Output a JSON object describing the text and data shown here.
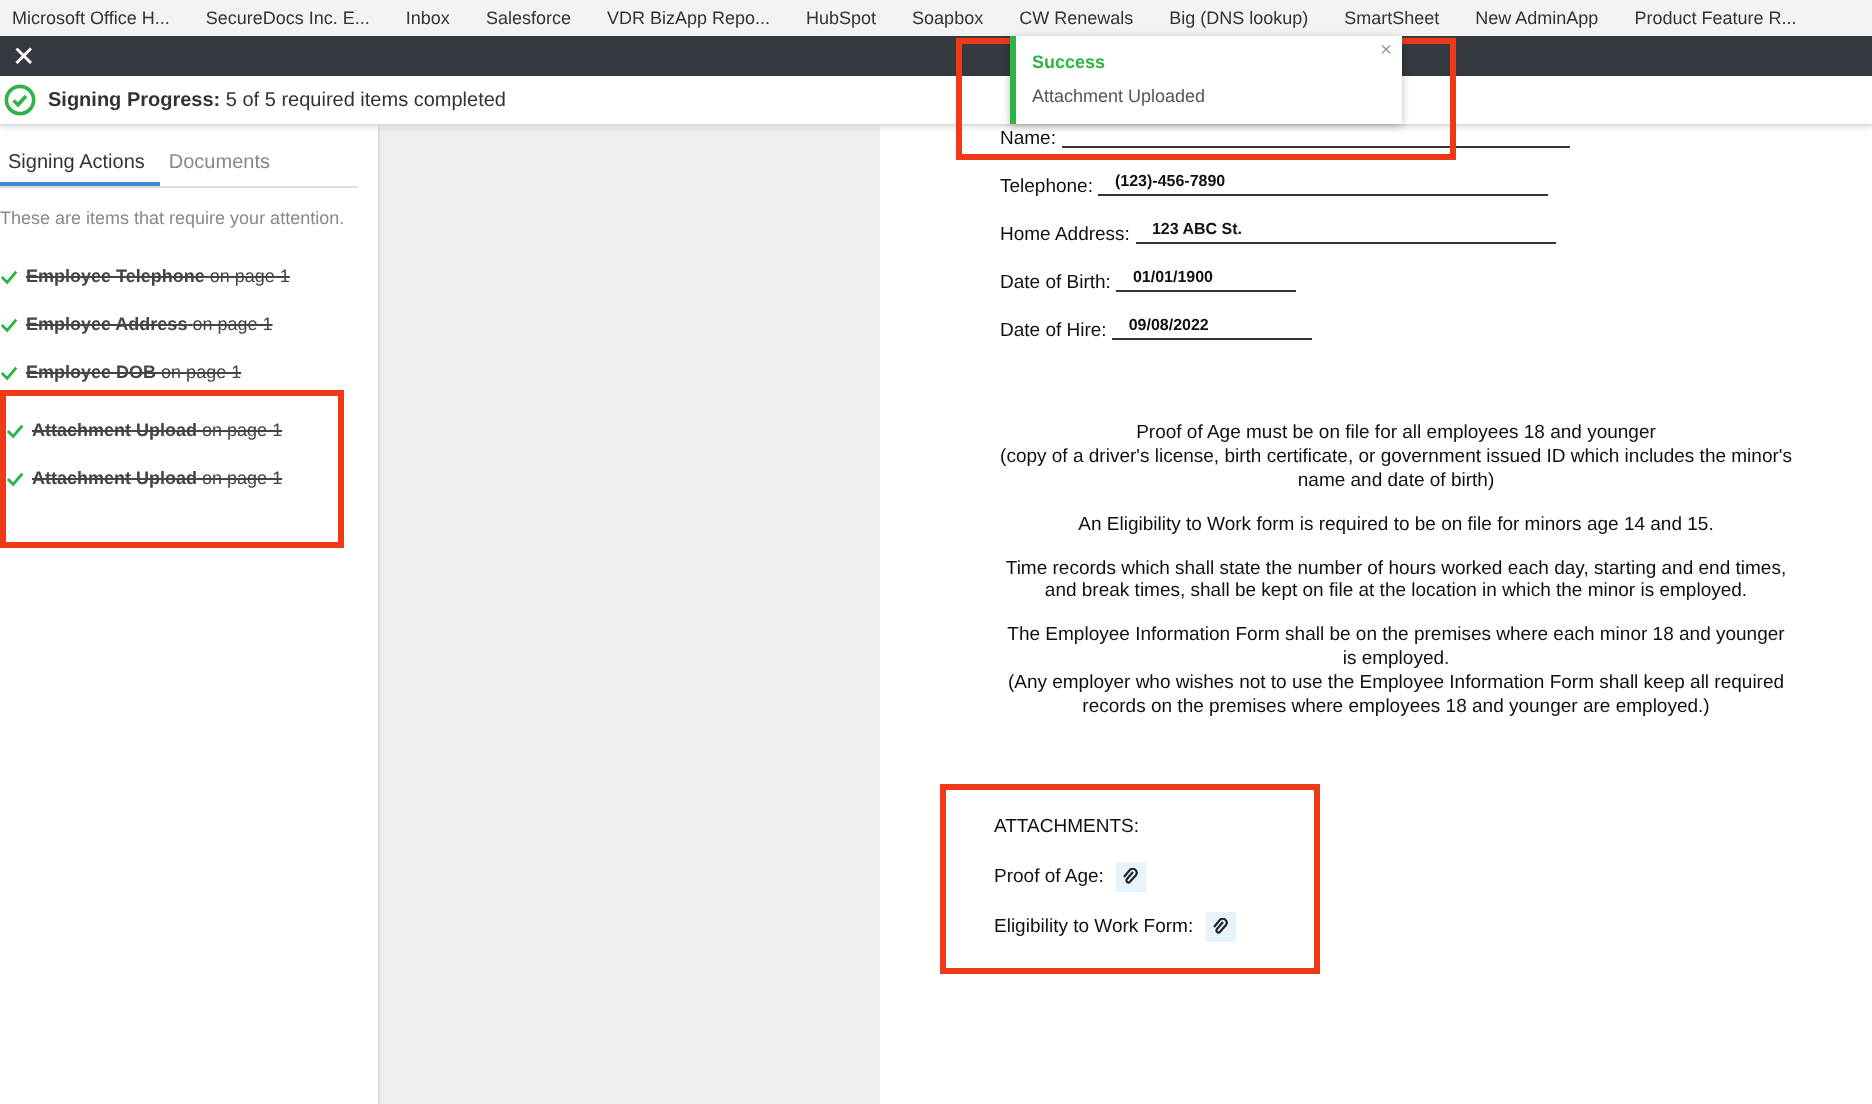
{
  "bookmarks": [
    "Microsoft Office H...",
    "SecureDocs Inc. E...",
    "Inbox",
    "Salesforce",
    "VDR BizApp Repo...",
    "HubSpot",
    "Soapbox",
    "CW Renewals",
    "Big (DNS lookup)",
    "SmartSheet",
    "New AdminApp",
    "Product Feature R..."
  ],
  "header": {
    "close": "✕"
  },
  "progress": {
    "label": "Signing Progress:",
    "text": "5 of 5 required items completed"
  },
  "toast": {
    "title": "Success",
    "message": "Attachment Uploaded",
    "close": "×"
  },
  "sidebar": {
    "tabs": [
      {
        "label": "Signing Actions",
        "selected": true
      },
      {
        "label": "Documents",
        "selected": false
      }
    ],
    "hint": "These are items that require your attention.",
    "items": [
      {
        "label": "Employee Telephone",
        "page": "on page 1",
        "done": true
      },
      {
        "label": "Employee Address",
        "page": "on page 1",
        "done": true
      },
      {
        "label": "Employee DOB",
        "page": "on page 1",
        "done": true
      },
      {
        "label": "Attachment Upload",
        "page": "on page 1",
        "done": true
      },
      {
        "label": "Attachment Upload",
        "page": "on page 1",
        "done": true
      }
    ]
  },
  "document": {
    "fields": [
      {
        "label": "Name:"
      },
      {
        "label": "Telephone:",
        "value": "(123)-456-7890"
      },
      {
        "label": "Home Address:",
        "value": "123 ABC St."
      },
      {
        "label": "Date of Birth:",
        "value": "01/01/1900"
      },
      {
        "label": "Date of Hire:",
        "value": "09/08/2022"
      }
    ],
    "paragraphs": [
      "Proof of Age must be on file for all employees 18 and younger\n(copy of a driver's license, birth certificate, or government issued ID which includes the minor's name and date of birth)",
      "An Eligibility to Work form is required to be on file for minors age 14 and 15.",
      "Time records which shall state the number of hours worked each day, starting and end times, and break times, shall be kept on file at the location in which the minor is employed.",
      "The Employee Information Form shall be on the premises where each minor 18 and younger is employed.\n(Any employer who wishes not to use the Employee Information Form shall keep all required records on the premises where employees 18 and younger are employed.)"
    ],
    "attachments_title": "ATTACHMENTS:",
    "attachments": [
      "Proof of Age:",
      "Eligibility to Work Form:"
    ]
  }
}
